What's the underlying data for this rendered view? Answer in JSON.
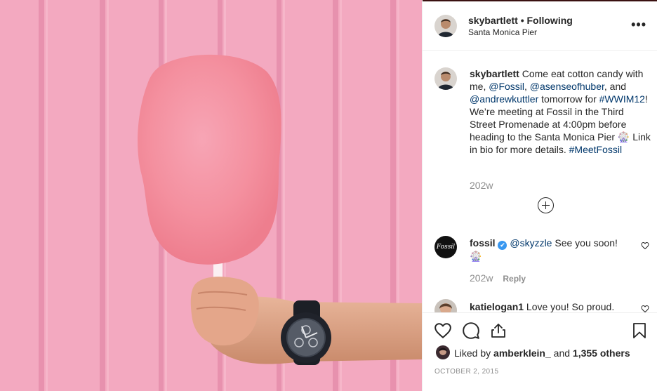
{
  "post": {
    "image_alt": "Hand holding pink cotton candy wearing a black watch in front of a pink wall"
  },
  "header": {
    "username": "skybartlett",
    "follow_status": "• Following",
    "location": "Santa Monica Pier",
    "more_label": "•••"
  },
  "caption": {
    "username": "skybartlett",
    "text_1": "Come eat cotton candy with me, ",
    "mention_1": "@Fossil",
    "text_2": ", ",
    "mention_2": "@asenseofhuber",
    "text_3": ", and ",
    "mention_3": "@andrewkuttler",
    "text_4": " tomorrow for ",
    "hashtag_1": "#WWIM12",
    "text_5": "! We’re meeting at Fossil in the Third Street Promenade at 4:00pm before heading to the Santa Monica Pier 🎡 Link in bio for more details. ",
    "hashtag_2": "#MeetFossil",
    "time": "202w"
  },
  "comments": [
    {
      "username": "fossil",
      "verified": "✔",
      "mention": "@skyzzle",
      "text": " See you soon!",
      "emoji": "🎡",
      "time": "202w",
      "reply_label": "Reply",
      "avatar_text": "Fossil"
    },
    {
      "username": "katielogan1",
      "text": " Love you! So proud."
    }
  ],
  "actions": {
    "liked_prefix": "Liked by ",
    "liked_user": "amberklein_",
    "liked_and": " and ",
    "liked_count": "1,355 others",
    "date": "OCTOBER 2, 2015"
  },
  "icons": [
    "heart-icon",
    "comment-icon",
    "share-icon",
    "bookmark-icon",
    "more-icon",
    "plus-circle-icon",
    "verified-icon"
  ],
  "colors": {
    "link": "#00376b",
    "muted": "#8e8e8e",
    "verified": "#3897f0",
    "wall_pink": "#f2a6bd"
  }
}
